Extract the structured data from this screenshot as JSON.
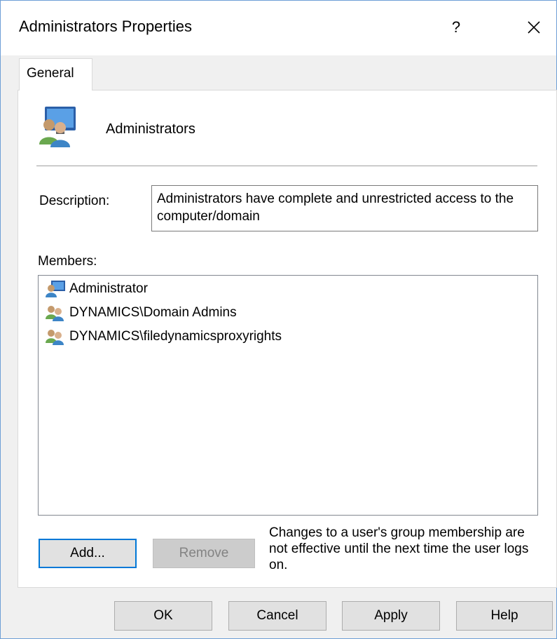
{
  "window": {
    "title": "Administrators Properties",
    "help_label": "?",
    "close_icon": "close-icon"
  },
  "tabs": [
    {
      "label": "General",
      "selected": true
    }
  ],
  "general": {
    "group_name": "Administrators",
    "description_label": "Description:",
    "description_value": "Administrators have complete and unrestricted access to the computer/domain",
    "members_label": "Members:",
    "members": [
      {
        "name": "Administrator",
        "icon": "user-icon"
      },
      {
        "name": "DYNAMICS\\Domain Admins",
        "icon": "group-icon"
      },
      {
        "name": "DYNAMICS\\filedynamicsproxyrights",
        "icon": "group-icon"
      }
    ],
    "add_label": "Add...",
    "remove_label": "Remove",
    "note": "Changes to a user's group membership are not effective until the next time the user logs on."
  },
  "footer": {
    "ok_label": "OK",
    "cancel_label": "Cancel",
    "apply_label": "Apply",
    "help_label": "Help"
  },
  "colors": {
    "accent": "#0078d7",
    "dialog_bg": "#f0f0f0",
    "button_bg": "#e1e1e1"
  }
}
